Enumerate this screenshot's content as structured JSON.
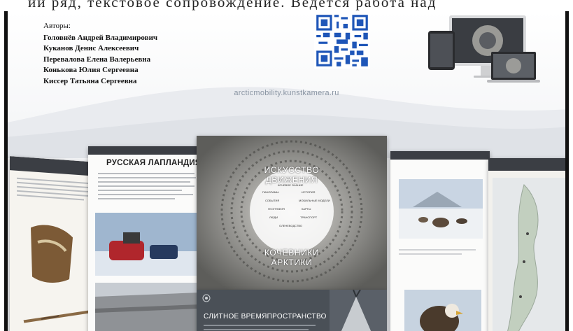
{
  "top_line": "ии ряд, текстовое сопровождение. Ведется работа над",
  "authors": {
    "header": "Авторы:",
    "names": [
      "Головнёв Андрей Владимирович",
      "Куканов Денис Алексеевич",
      "Перевалова Елена Валерьевна",
      "Конькова Юлия Сергеевна",
      "Киссер Татьяна Сергеевна"
    ]
  },
  "site_url": "arcticmobility.kunstkamera.ru",
  "pages": {
    "left_title": "РУССКАЯ ЛАПЛАНДИЯ",
    "center_ring_top": "ИСКУССТВО ДВИЖЕНИЯ",
    "center_ring_bottom": "КОЧЕВНИКИ АРКТИКИ",
    "center_menu": [
      "КОЧЕВОЕ ЗНАНИЕ",
      "ПАНОРАМЫ",
      "ИСТОРИЯ",
      "СОБЫТИЯ",
      "МОБИЛЬНЫЕ МОДЕЛИ",
      "ГЕОГРАФИЯ",
      "КАРТЫ",
      "ЛЮДИ",
      "ТРАНСПОРТ",
      "ОЛЕНЕВОДСТВО"
    ],
    "dark_title": "СЛИТНОЕ ВРЕМЯПРОСТРАНСТВО"
  },
  "colors": {
    "qr_blue": "#1f56b8",
    "frame_bar": "#111111",
    "url_text": "#8b96a4"
  }
}
